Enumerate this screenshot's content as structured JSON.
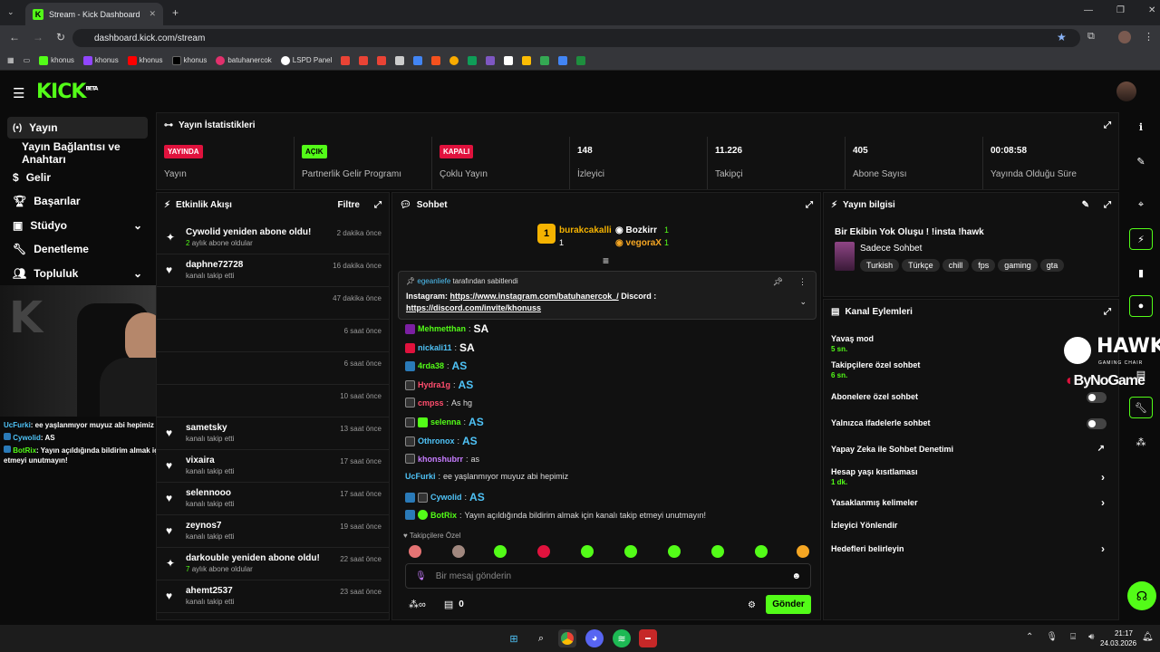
{
  "browser": {
    "tab_title": "Stream - Kick Dashboard",
    "url": "dashboard.kick.com/stream",
    "bookmarks": [
      "khonus",
      "khonus",
      "khonus",
      "khonus",
      "batuhanercok",
      "LSPD Panel"
    ]
  },
  "app": {
    "logo": "KICK",
    "logo_sup": "BETA"
  },
  "sidebar": {
    "items": [
      {
        "label": "Yayın",
        "icon": "broadcast-icon"
      },
      {
        "label": "Yayın Bağlantısı ve Anahtarı"
      },
      {
        "label": "Gelir",
        "icon": "dollar-icon"
      },
      {
        "label": "Başarılar",
        "icon": "trophy-icon"
      },
      {
        "label": "Stüdyo",
        "icon": "studio-icon"
      },
      {
        "label": "Denetleme",
        "icon": "wrench-icon"
      },
      {
        "label": "Topluluk",
        "icon": "people-icon"
      }
    ]
  },
  "webcam_chat": [
    {
      "user": "UcFurki",
      "text": ": ee yaşlanmıyor muyuz abi hepimiz"
    },
    {
      "user": "Cywolid",
      "text": ": AS"
    },
    {
      "user": "BotRix",
      "text": ": Yayın açıldığında bildirim almak için kanalı takip etmeyi unutmayın!"
    }
  ],
  "stats": {
    "title": "Yayın İstatistikleri",
    "cells": [
      {
        "badge": "YAYINDA",
        "label": "Yayın"
      },
      {
        "badge": "AÇIK",
        "label": "Partnerlik Gelir Programı"
      },
      {
        "badge": "KAPALI",
        "label": "Çoklu Yayın"
      },
      {
        "value": "148",
        "label": "İzleyici"
      },
      {
        "value": "11.226",
        "label": "Takipçi"
      },
      {
        "value": "405",
        "label": "Abone Sayısı"
      },
      {
        "value": "00:08:58",
        "label": "Yayında Olduğu Süre"
      }
    ]
  },
  "activity": {
    "title": "Etkinlik Akışı",
    "filter": "Filtre",
    "items": [
      {
        "name": "Cywolid yeniden abone oldu!",
        "sub_highlight": "2",
        "sub": "aylık abone oldular",
        "time": "2 dakika önce",
        "icon": "sparkle-icon"
      },
      {
        "name": "daphne72728",
        "sub": "kanalı takip etti",
        "time": "16 dakika önce",
        "icon": "heart-icon"
      },
      {
        "name": "",
        "sub": "",
        "time": "47 dakika önce",
        "icon": ""
      },
      {
        "name": "",
        "sub": "",
        "time": "6 saat önce",
        "icon": ""
      },
      {
        "name": "",
        "sub": "",
        "time": "6 saat önce",
        "icon": ""
      },
      {
        "name": "",
        "sub": "",
        "time": "10 saat önce",
        "icon": ""
      },
      {
        "name": "sametsky",
        "sub": "kanalı takip etti",
        "time": "13 saat önce",
        "icon": "heart-icon"
      },
      {
        "name": "vixaira",
        "sub": "kanalı takip etti",
        "time": "17 saat önce",
        "icon": "heart-icon"
      },
      {
        "name": "selennooo",
        "sub": "kanalı takip etti",
        "time": "17 saat önce",
        "icon": "heart-icon"
      },
      {
        "name": "zeynos7",
        "sub": "kanalı takip etti",
        "time": "19 saat önce",
        "icon": "heart-icon"
      },
      {
        "name": "darkouble yeniden abone oldu!",
        "sub_highlight": "7",
        "sub": "aylık abone oldular",
        "time": "22 saat önce",
        "icon": "sparkle-icon"
      },
      {
        "name": "ahemt2537",
        "sub": "kanalı takip etti",
        "time": "23 saat önce",
        "icon": "heart-icon"
      }
    ]
  },
  "chat": {
    "title": "Sohbet",
    "top": [
      {
        "rank": "1",
        "name": "burakcakalli",
        "count": "1"
      },
      {
        "name": "Bozkirr",
        "count": "1"
      },
      {
        "name": "vegoraX",
        "count": "1"
      }
    ],
    "pinned": {
      "by": "egeanliefe",
      "by_suffix": "tarafından sabitlendi",
      "text": "Instagram: ",
      "link1": "https://www.instagram.com/batuhanercok_/",
      "mid": " Discord :",
      "link2": "https://discord.com/invite/khonuss"
    },
    "messages": [
      {
        "user": "Mehmetthan",
        "text": "SA",
        "color": "#53fc18",
        "big": true
      },
      {
        "user": "nickali11",
        "text": "SA",
        "color": "#4fc3f7",
        "big": true
      },
      {
        "user": "4rda38",
        "text": "AS",
        "color": "#53fc18",
        "big": true
      },
      {
        "user": "Hydra1g",
        "text": "AS",
        "color": "#ff4d6d",
        "big": true
      },
      {
        "user": "cmpss",
        "text": "As hg",
        "color": "#ff4d6d",
        "big": false
      },
      {
        "user": "selenna",
        "text": "AS",
        "color": "#53fc18",
        "big": true
      },
      {
        "user": "Othronox",
        "text": "AS",
        "color": "#4fc3f7",
        "big": true
      },
      {
        "user": "khonshubrr",
        "text": "as",
        "color": "#c77dff",
        "big": false
      },
      {
        "user": "UcFurki",
        "text": "ee yaşlanmıyor muyuz abi hepimiz",
        "color": "#4fc3f7",
        "big": false
      },
      {
        "user": "Cywolid",
        "text": "AS",
        "color": "#4fc3f7",
        "big": true
      },
      {
        "user": "BotRix",
        "text": "Yayın açıldığında bildirim almak için kanalı takip etmeyi unutmayın!",
        "color": "#53fc18",
        "big": false
      }
    ],
    "followers_only": "Takipçilere Özel",
    "input_placeholder": "Bir mesaj gönderin",
    "points": "0",
    "send": "Gönder"
  },
  "stream_info": {
    "title": "Yayın bilgisi",
    "stream_title": "Bir Ekibin Yok Oluşu ! !insta !hawk",
    "category": "Sadece Sohbet",
    "tags": [
      "Turkish",
      "Türkçe",
      "chill",
      "fps",
      "gaming",
      "gta"
    ]
  },
  "channel_actions": {
    "title": "Kanal Eylemleri",
    "items": [
      {
        "label": "Yavaş mod",
        "sub": "5 sn.",
        "control": "none"
      },
      {
        "label": "Takipçilere özel sohbet",
        "sub": "6 sn.",
        "control": "none"
      },
      {
        "label": "Abonelere özel sohbet",
        "sub": "",
        "control": "toggle"
      },
      {
        "label": "Yalnızca ifadelerle sohbet",
        "sub": "",
        "control": "toggle"
      },
      {
        "label": "Yapay Zeka ile Sohbet Denetimi",
        "sub": "",
        "control": "external"
      },
      {
        "label": "Hesap yaşı kısıtlaması",
        "sub": "1 dk.",
        "control": "chevron"
      },
      {
        "label": "Yasaklanmış kelimeler",
        "sub": "",
        "control": "chevron"
      },
      {
        "label": "İzleyici Yönlendir",
        "sub": "",
        "control": "none"
      },
      {
        "label": "Hedefleri belirleyin",
        "sub": "",
        "control": "chevron"
      }
    ]
  },
  "overlay": {
    "brand1": "HAWK",
    "brand1_sub": "GAMING CHAIR",
    "brand2": "ByNoGame"
  },
  "taskbar": {
    "time": "21:17",
    "date": "24.03.2026"
  }
}
